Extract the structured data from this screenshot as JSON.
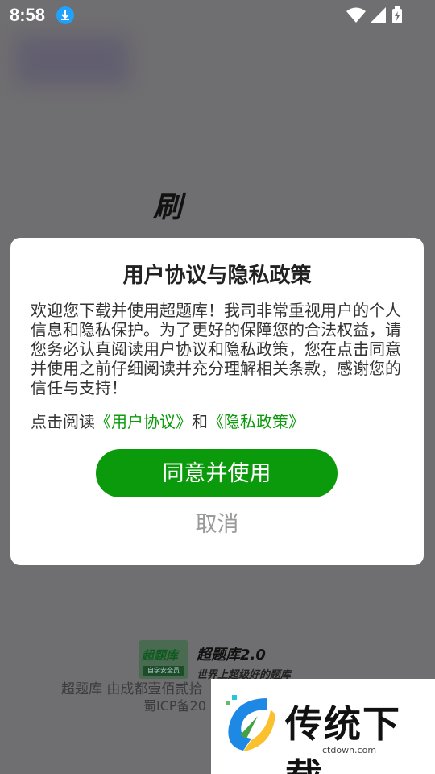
{
  "status_bar": {
    "time": "8:58",
    "icons": [
      "download-icon",
      "wifi-icon",
      "signal-icon",
      "battery-icon"
    ]
  },
  "splash": {
    "title_char": "刷",
    "brand_name": "超题库2.0",
    "slogan": "世界上超级好的题库",
    "logo_text": "超题库",
    "logo_tag": "自学安全员",
    "footer_line1": "超题库 由成都壹佰贰拾",
    "footer_line2": "蜀ICP备20"
  },
  "dialog": {
    "title": "用户协议与隐私政策",
    "body": "欢迎您下载并使用超题库！我司非常重视用户的个人信息和隐私保护。为了更好的保障您的合法权益，请您务必认真阅读用户协议和隐私政策，您在点击同意并使用之前仔细阅读并充分理解相关条款，感谢您的信任与支持！",
    "links_prefix": "点击阅读",
    "user_agreement_link": "《用户协议》",
    "links_join": "和",
    "privacy_policy_link": "《隐私政策》",
    "agree_button": "同意并使用",
    "cancel_button": "取消"
  },
  "watermark": {
    "text": "传统下载",
    "url": "ctdown.com"
  },
  "colors": {
    "accent_green": "#0b9a0b",
    "overlay": "#6f6e70",
    "download_badge": "#1fa3ff"
  }
}
